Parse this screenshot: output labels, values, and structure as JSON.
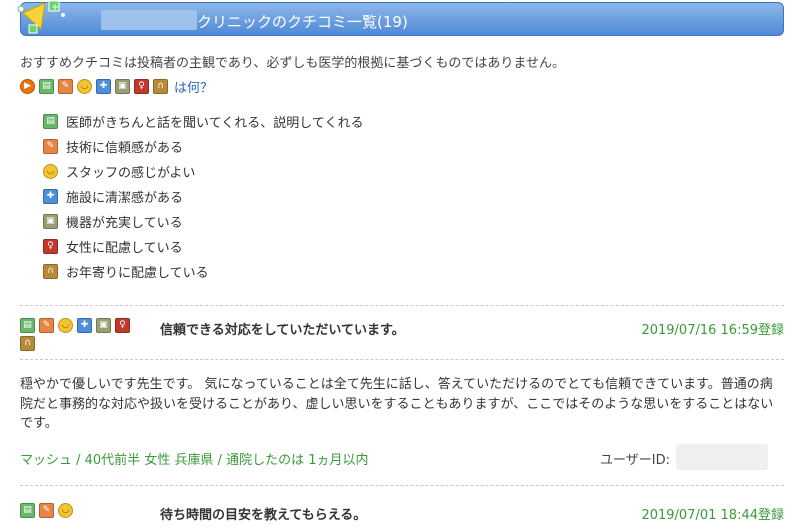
{
  "header": {
    "title": "クリニックのクチコミ一覧(19)"
  },
  "notice": "おすすめクチコミは投稿者の主観であり、必ずしも医学的根拠に基づくものではありません。",
  "what_link": "は何？",
  "legend": [
    {
      "icon": "doctor-icon",
      "label": "医師がきちんと話を聞いてくれる、説明してくれる"
    },
    {
      "icon": "tech-icon",
      "label": "技術に信頼感がある"
    },
    {
      "icon": "staff-icon",
      "label": "スタッフの感じがよい"
    },
    {
      "icon": "clean-icon",
      "label": "施設に清潔感がある"
    },
    {
      "icon": "equipment-icon",
      "label": "機器が充実している"
    },
    {
      "icon": "women-icon",
      "label": "女性に配慮している"
    },
    {
      "icon": "elderly-icon",
      "label": "お年寄りに配慮している"
    }
  ],
  "reviews": [
    {
      "title": "信頼できる対応をしていただいています。",
      "date": "2019/07/16 16:59登録",
      "body": "穏やかで優しいです先生です。 気になっていることは全て先生に話し、答えていただけるのでとても信頼できています。普通の病院だと事務的な対応や扱いを受けることがあり、虚しい思いをすることもありますが、ここではそのような思いをすることはないです。",
      "meta": "マッシュ / 40代前半 女性 兵庫県 / 通院したのは 1ヵ月以内",
      "user_id_label": "ユーザーID:"
    },
    {
      "title": "待ち時間の目安を教えてもらえる。",
      "date": "2019/07/01 18:44登録"
    }
  ]
}
